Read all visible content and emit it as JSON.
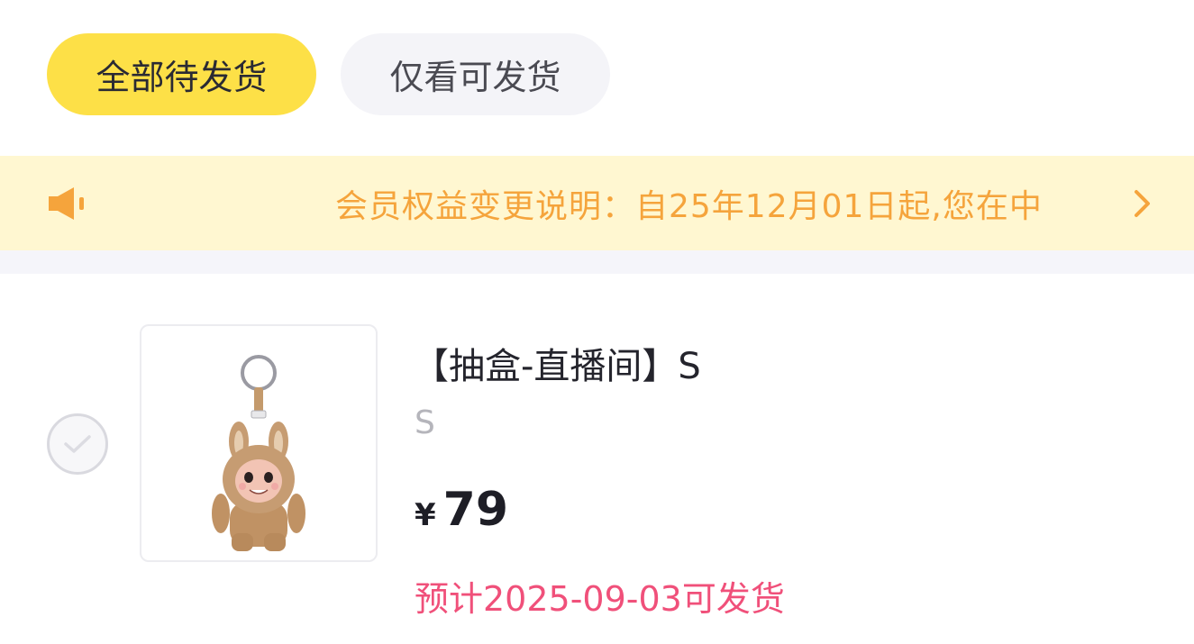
{
  "filters": {
    "all_pending": "全部待发货",
    "only_shippable": "仅看可发货"
  },
  "notice": {
    "icon": "speaker-icon",
    "text": "会员权益变更说明：自25年12月01日起,您在中",
    "arrow_icon": "chevron-right-icon",
    "color": "#f5a43c"
  },
  "item": {
    "title": "【抽盒-直播间】S",
    "spec": "S",
    "currency": "¥",
    "price": "79",
    "ship_date": "预计2025-09-03可发货",
    "ship_color": "#f0507a"
  },
  "colors": {
    "accent": "#fde047",
    "notice_bg": "#fff7d1"
  }
}
